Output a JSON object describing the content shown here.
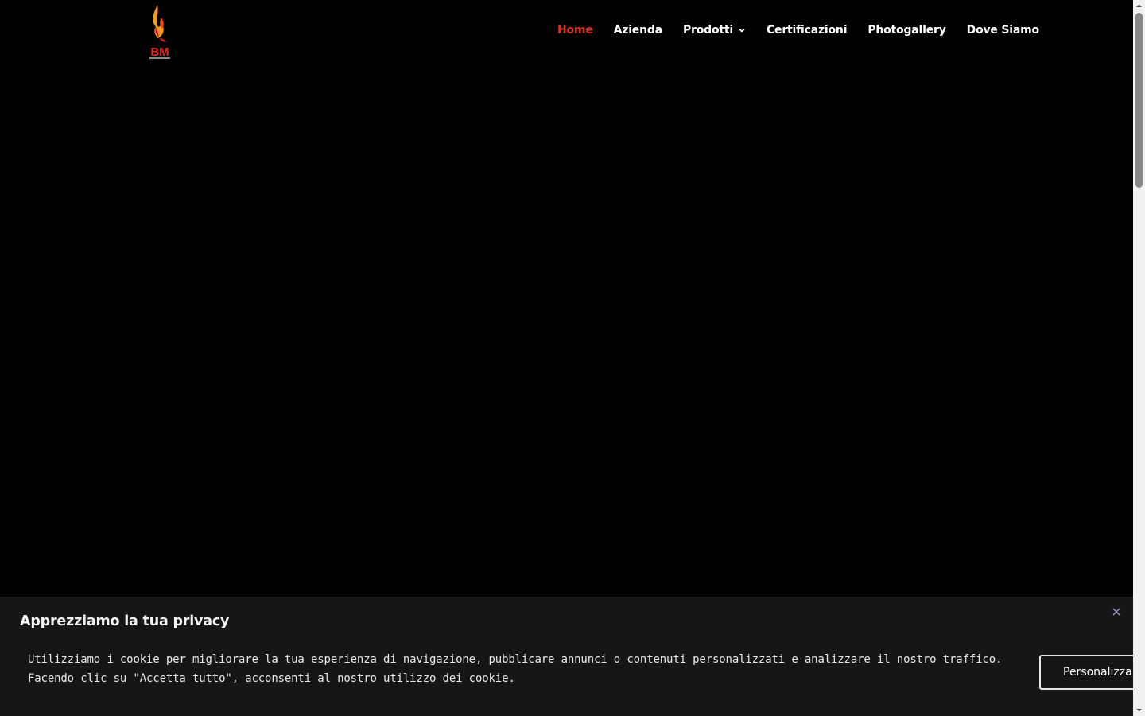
{
  "header": {
    "logo_text": "BM",
    "nav": [
      {
        "label": "Home",
        "active": true,
        "has_submenu": false
      },
      {
        "label": "Azienda",
        "active": false,
        "has_submenu": false
      },
      {
        "label": "Prodotti",
        "active": false,
        "has_submenu": true
      },
      {
        "label": "Certificazioni",
        "active": false,
        "has_submenu": false
      },
      {
        "label": "Photogallery",
        "active": false,
        "has_submenu": false
      },
      {
        "label": "Dove Siamo",
        "active": false,
        "has_submenu": false
      }
    ]
  },
  "cookie_banner": {
    "title": "Apprezziamo la tua privacy",
    "text_line1": "Utilizziamo i cookie per migliorare la tua esperienza di navigazione, pubblicare annunci o contenuti personalizzati e analizzare il nostro traffico.",
    "text_line2": "Facendo clic su \"Accetta tutto\", acconsenti al nostro utilizzo dei cookie.",
    "customize_label": "Personalizza"
  },
  "icons": {
    "close": "close-icon",
    "submenu": "chevron-down-icon",
    "logo": "flame-logo-icon"
  },
  "colors": {
    "background": "#000000",
    "accent": "#e02b20",
    "nav_text": "#ffffff",
    "banner_bg": "#161616"
  }
}
